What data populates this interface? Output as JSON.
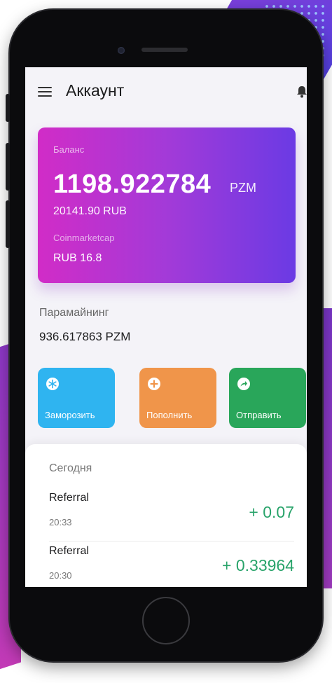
{
  "header": {
    "title": "Аккаунт",
    "menu_icon": "hamburger-menu-icon",
    "bell_icon": "bell-icon"
  },
  "balance_card": {
    "label": "Баланс",
    "amount": "1198.922784",
    "unit": "PZM",
    "rub_value": "20141.90 RUB",
    "coinmarketcap_label": "Coinmarketcap",
    "coinmarketcap_rate": "RUB 16.8"
  },
  "paramining": {
    "label": "Парамайнинг",
    "value": "936.617863  PZM"
  },
  "actions": [
    {
      "label": "Заморозить",
      "icon": "snowflake-icon",
      "color": "#2fb4f0"
    },
    {
      "label": "Пополнить",
      "icon": "plus-circle-icon",
      "color": "#f0954a"
    },
    {
      "label": "Отправить",
      "icon": "send-arrow-icon",
      "color": "#29a65a"
    }
  ],
  "transactions": {
    "section_title": "Сегодня",
    "items": [
      {
        "name": "Referral",
        "time": "20:33",
        "amount": "+ 0.07"
      },
      {
        "name": "Referral",
        "time": "20:30",
        "amount": "+ 0.33964"
      }
    ]
  },
  "colors": {
    "card_gradient_start": "#d12cc7",
    "card_gradient_end": "#6b3ae4",
    "positive_amount": "#28a36a"
  }
}
